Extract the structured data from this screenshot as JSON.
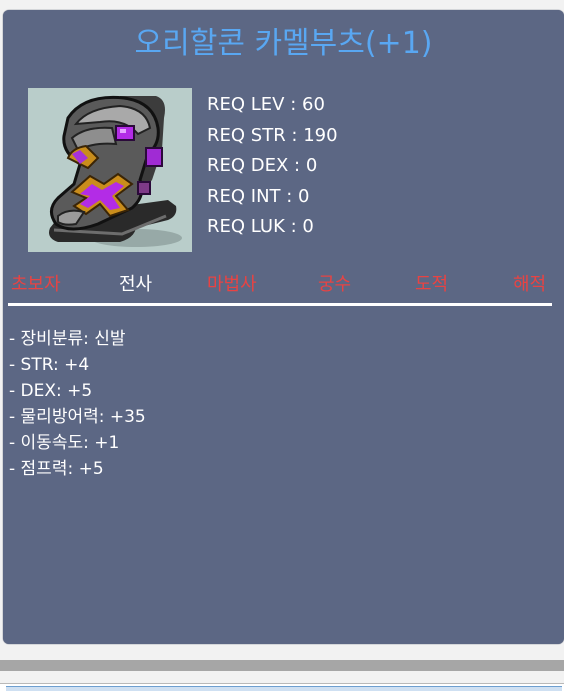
{
  "item": {
    "name": "오리할콘 카멜부츠(+1)"
  },
  "requirements": [
    "REQ LEV : 60",
    "REQ STR : 190",
    "REQ DEX : 0",
    "REQ INT : 0",
    "REQ LUK : 0"
  ],
  "jobs": [
    {
      "label": "초보자",
      "active": false
    },
    {
      "label": "전사",
      "active": true
    },
    {
      "label": "마법사",
      "active": false
    },
    {
      "label": "궁수",
      "active": false
    },
    {
      "label": "도적",
      "active": false
    },
    {
      "label": "해적",
      "active": false
    }
  ],
  "stats": [
    "- 장비분류: 신발",
    "- STR: +4",
    "- DEX: +5",
    "- 물리방어력: +35",
    "- 이동속도: +1",
    "- 점프력: +5"
  ],
  "colors": {
    "panel": "#5c6784",
    "title": "#59a7f2",
    "job_inactive": "#e84343",
    "job_active": "#ffffff",
    "item_bg": "#b9cdca"
  },
  "icons": {
    "item": "camel-boots-icon"
  }
}
